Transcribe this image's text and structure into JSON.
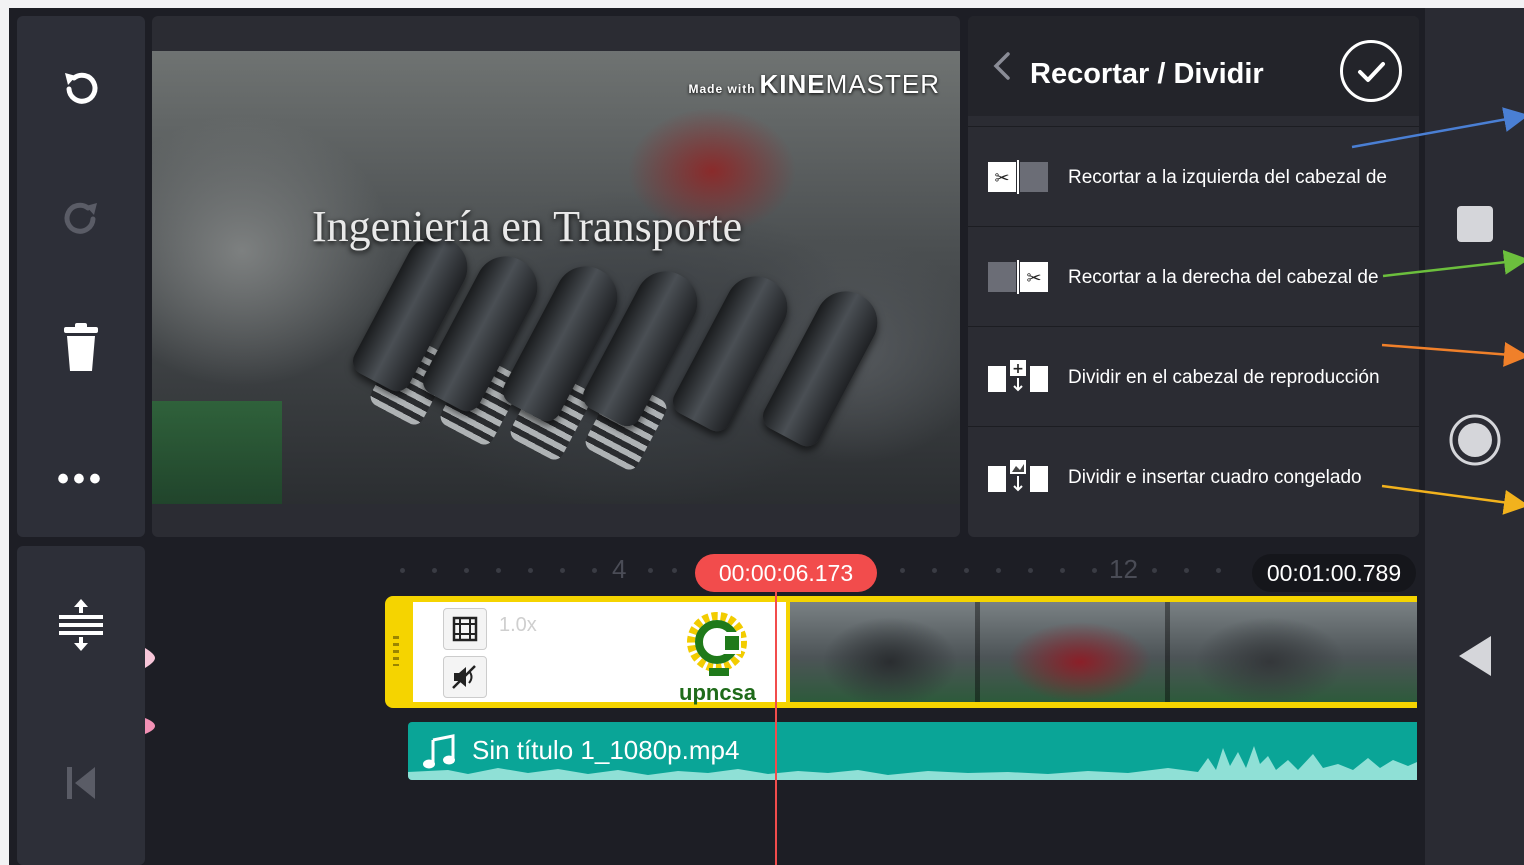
{
  "colors": {
    "accent_red": "#f24c4c",
    "clip_yellow": "#f5d400",
    "audio_teal": "#0aa597",
    "panel_bg": "#2b2c33",
    "annotation_blue": "#4a7fd4",
    "annotation_green": "#6cbf3d",
    "annotation_orange": "#f0802a",
    "annotation_yellow": "#f2b21d"
  },
  "sidebar": {
    "undo_icon": "undo-icon",
    "redo_icon": "redo-icon",
    "delete_icon": "trash-icon",
    "more_icon": "more-icon",
    "more_label": "•••",
    "expand_icon": "expand-tracks-icon",
    "jump_start_icon": "skip-to-start-icon"
  },
  "preview": {
    "watermark_prefix": "Made with",
    "watermark_brand_bold": "KINE",
    "watermark_brand_light": "MASTER",
    "title_overlay": "Ingeniería en Transporte"
  },
  "trim_panel": {
    "title": "Recortar / Dividir",
    "items": [
      {
        "label": "Recortar a la izquierda del cabezal de",
        "icon": "trim-left-icon"
      },
      {
        "label": "Recortar a la derecha del cabezal de",
        "icon": "trim-right-icon"
      },
      {
        "label": "Dividir en el cabezal de reproducción",
        "icon": "split-icon"
      },
      {
        "label": "Dividir e insertar cuadro congelado",
        "icon": "split-freeze-icon"
      }
    ]
  },
  "timeline": {
    "ruler_labels": [
      "4",
      "12"
    ],
    "playhead_time": "00:00:06.173",
    "total_time": "00:01:00.789",
    "video_clip": {
      "speed": "1.0x",
      "logo_text": "upncsa"
    },
    "audio_clip": {
      "name": "Sin título 1_1080p.mp4"
    }
  },
  "nav": {
    "items": [
      "stop-icon",
      "record-icon",
      "back-icon"
    ]
  }
}
